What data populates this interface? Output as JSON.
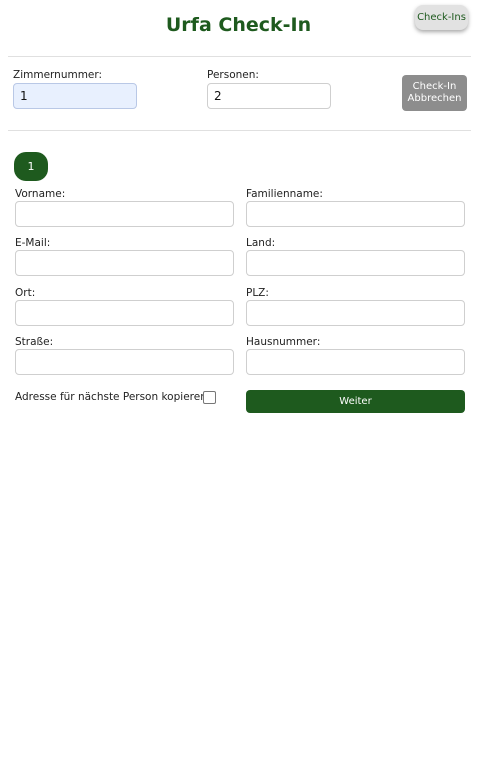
{
  "header": {
    "title": "Urfa Check-In",
    "checkins_button": "Check-Ins"
  },
  "room_bar": {
    "room_label": "Zimmernummer:",
    "room_value": "1",
    "persons_label": "Personen:",
    "persons_value": "2",
    "cancel_line1": "Check-In",
    "cancel_line2": "Abbrechen"
  },
  "tabs": [
    {
      "label": "1",
      "active": true
    }
  ],
  "form": {
    "first_name_label": "Vorname:",
    "last_name_label": "Familienname:",
    "email_label": "E-Mail:",
    "country_label": "Land:",
    "city_label": "Ort:",
    "zip_label": "PLZ:",
    "street_label": "Straße:",
    "house_number_label": "Hausnummer:",
    "first_name_value": "",
    "last_name_value": "",
    "email_value": "",
    "country_value": "",
    "city_value": "",
    "zip_value": "",
    "street_value": "",
    "house_number_value": ""
  },
  "footer": {
    "copy_label": "Adresse für nächste Person kopieren",
    "copy_checked": false,
    "next_button": "Weiter"
  },
  "colors": {
    "brand_green": "#1e5a1e",
    "cancel_gray": "#8d8d8d",
    "active_input_bg": "#e8f0fe"
  }
}
